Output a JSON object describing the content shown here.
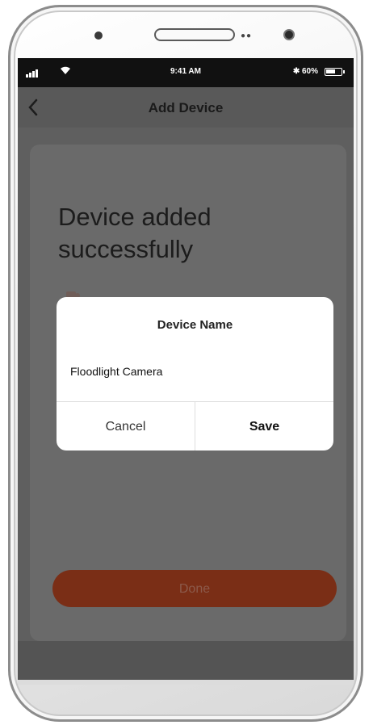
{
  "statusbar": {
    "time": "9:41 AM",
    "battery": "60%",
    "icons": [
      "signal-icon",
      "wifi-icon",
      "bluetooth-icon",
      "battery-icon"
    ]
  },
  "navbar": {
    "title": "Add Device",
    "back_icon": "chevron-left-icon"
  },
  "card": {
    "headline": "Device added successfully",
    "done_label": "Done"
  },
  "dialog": {
    "title": "Device Name",
    "input_value": "Floodlight Camera",
    "cancel_label": "Cancel",
    "save_label": "Save"
  },
  "colors": {
    "accent": "#7a2e16",
    "overlay": "#5f5f5f",
    "statusbar": "#111111"
  }
}
